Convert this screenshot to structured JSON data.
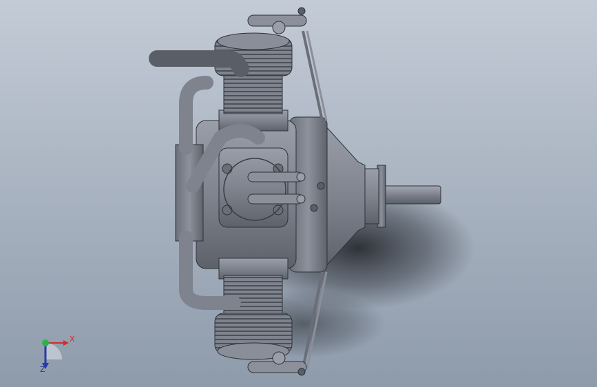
{
  "viewport": {
    "background_top": "#c3cbd6",
    "background_bottom": "#8e9bab",
    "model_icon": "radial-engine-icon"
  },
  "triad": {
    "x_label": "X",
    "z_label": "Z",
    "x_color": "#d22b2b",
    "y_color": "#2fb24a",
    "z_color": "#2a3aa8"
  }
}
